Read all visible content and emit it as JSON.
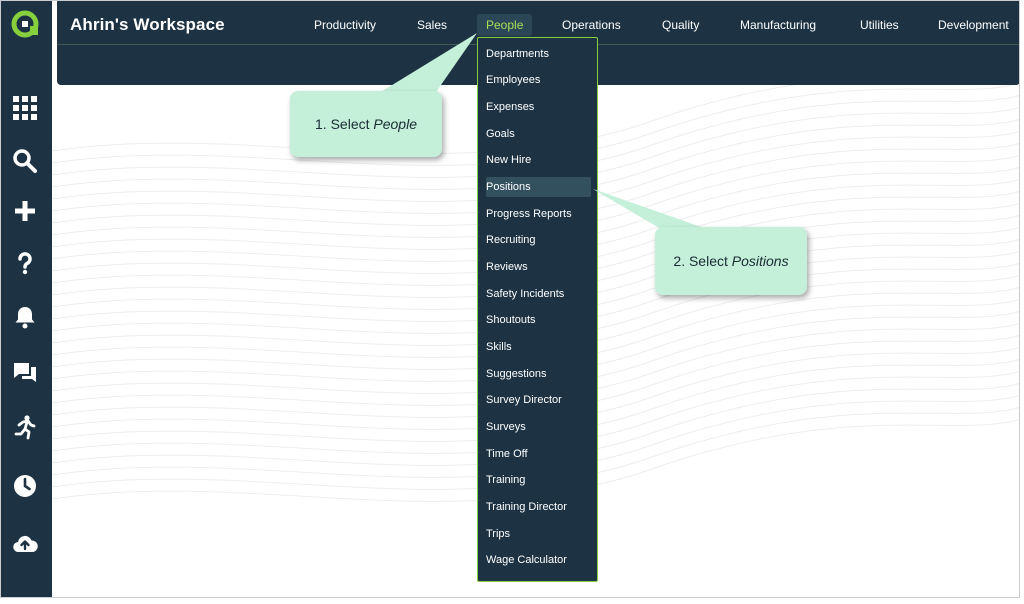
{
  "workspace_title": "Ahrin's Workspace",
  "nav": [
    {
      "label": "Productivity"
    },
    {
      "label": "Sales"
    },
    {
      "label": "People"
    },
    {
      "label": "Operations"
    },
    {
      "label": "Quality"
    },
    {
      "label": "Manufacturing"
    },
    {
      "label": "Utilities"
    },
    {
      "label": "Development"
    }
  ],
  "active_nav": "People",
  "dropdown": [
    "Departments",
    "Employees",
    "Expenses",
    "Goals",
    "New Hire",
    "Positions",
    "Progress Reports",
    "Recruiting",
    "Reviews",
    "Safety Incidents",
    "Shoutouts",
    "Skills",
    "Suggestions",
    "Survey Director",
    "Surveys",
    "Time Off",
    "Training",
    "Training Director",
    "Trips",
    "Wage Calculator"
  ],
  "highlighted_item": "Positions",
  "callouts": {
    "step1_prefix": "1. Select ",
    "step1_target": "People",
    "step2_prefix": "2. Select ",
    "step2_target": "Positions"
  },
  "rail_icons": [
    "apps-grid-icon",
    "search-icon",
    "plus-icon",
    "help-icon",
    "bell-icon",
    "chat-icon",
    "running-icon",
    "clock-icon",
    "cloud-upload-icon"
  ],
  "colors": {
    "navy": "#1d3343",
    "accent_green": "#86cf3d",
    "callout_bg": "#c4efd9"
  }
}
